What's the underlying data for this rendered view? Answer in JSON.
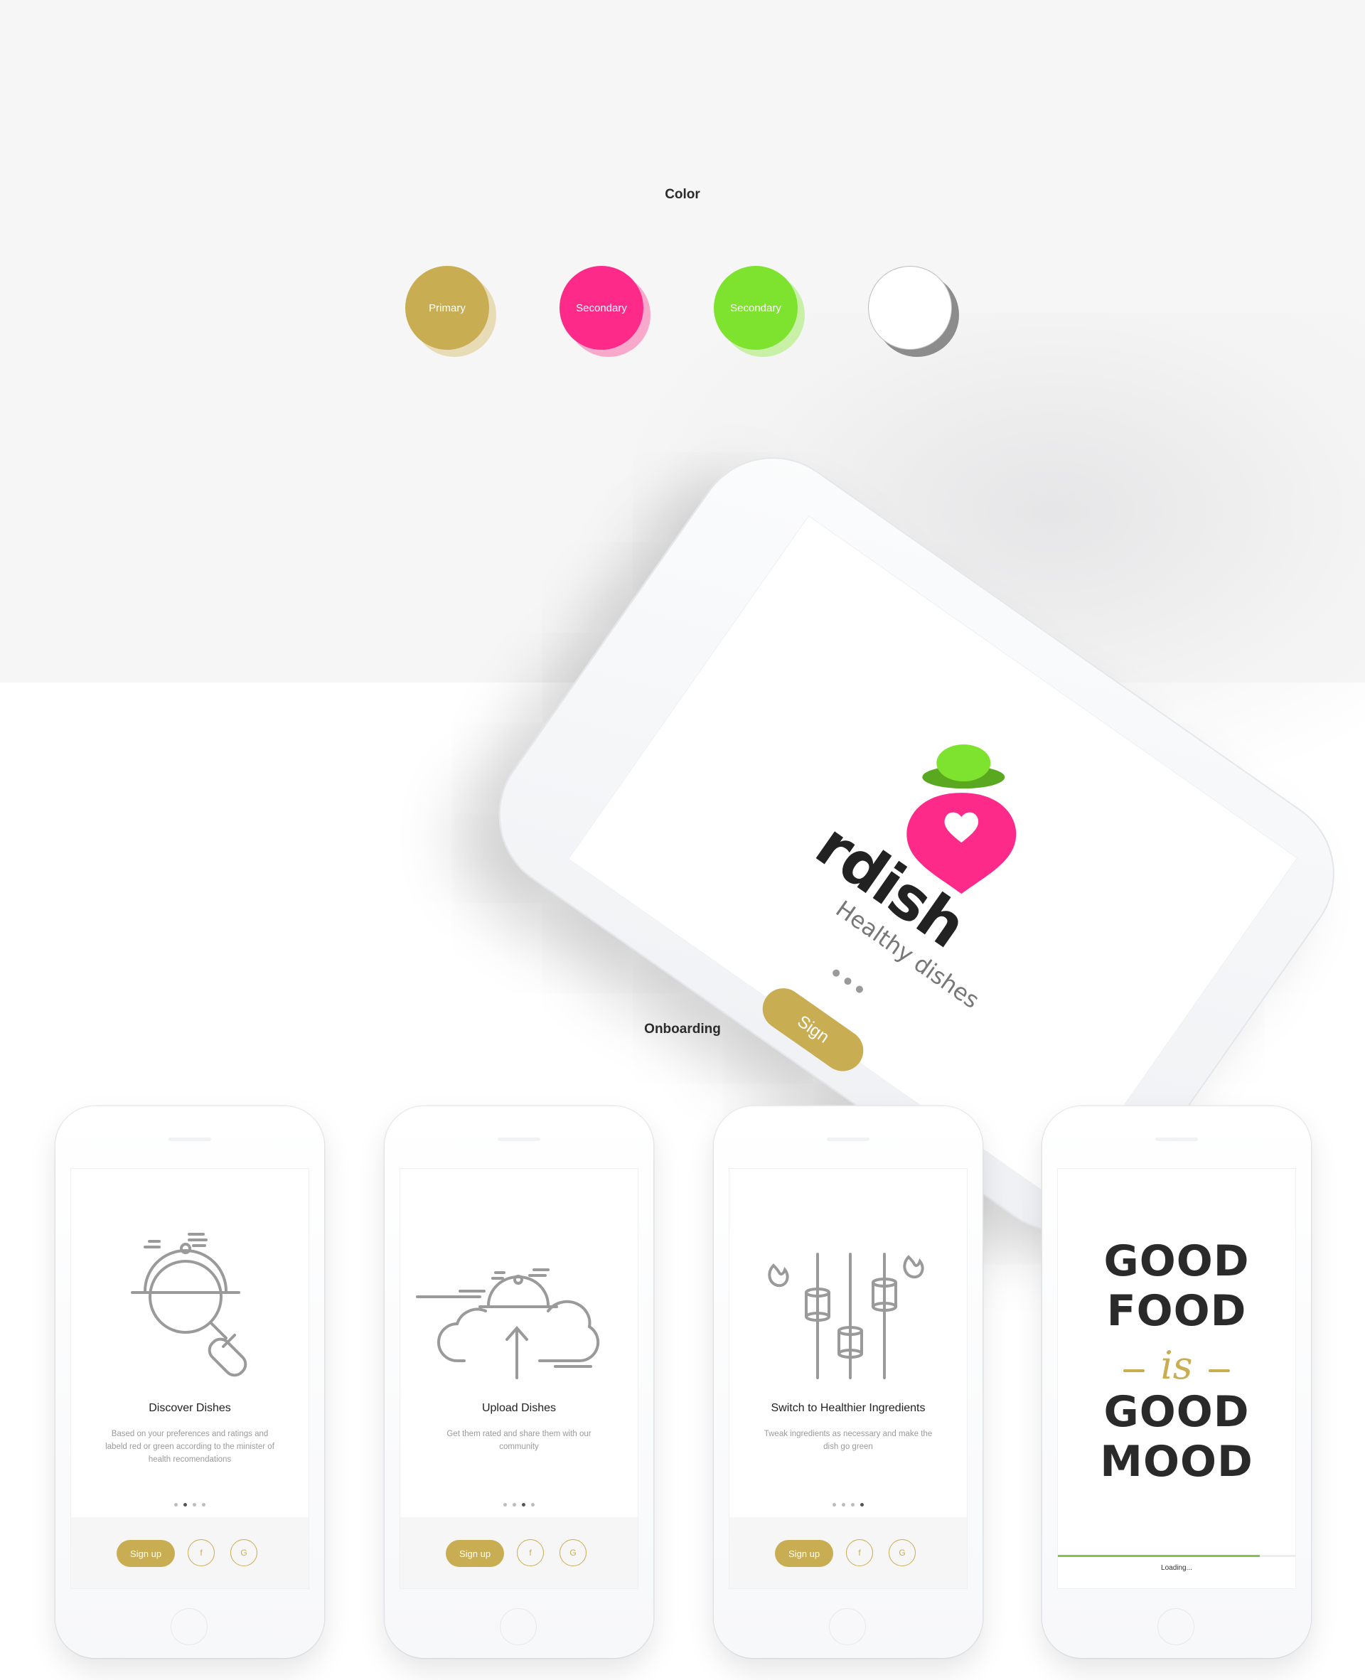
{
  "sections": {
    "color_title": "Color",
    "onboarding_title": "Onboarding"
  },
  "colors": {
    "primary": "#c9ad52",
    "secondary_pink": "#fe2a8a",
    "secondary_green": "#7ee32f",
    "white": "#ffffff"
  },
  "swatches": [
    {
      "label": "Primary",
      "color": "#c9ad52",
      "shadow": "#e8dcb6"
    },
    {
      "label": "Secondary",
      "color": "#fe2a8a",
      "shadow": "#f7a8cb"
    },
    {
      "label": "Secondary",
      "color": "#7ee32f",
      "shadow": "#c8f0a6"
    },
    {
      "label": "",
      "color": "#ffffff",
      "shadow": "#8c8c8c"
    }
  ],
  "splash": {
    "brand": "rdish",
    "tagline": "Healthy dishes",
    "signup_label": "Sign"
  },
  "onboarding": [
    {
      "title": "Discover Dishes",
      "description": "Based on your preferences and ratings and labeld red or green according to the minister of health recomendations",
      "icon": "cloche-magnifier-icon",
      "active_dot": 2
    },
    {
      "title": "Upload Dishes",
      "description": "Get them rated and share them with our community",
      "icon": "cloud-upload-cloche-icon",
      "active_dot": 3
    },
    {
      "title": "Switch to Healthier Ingredients",
      "description": "Tweak ingredients as necessary and make the dish go green",
      "icon": "ingredient-sliders-icon",
      "active_dot": 4
    }
  ],
  "buttons": {
    "signup": "Sign up",
    "facebook": "f",
    "google": "G"
  },
  "quote_screen": {
    "line1": "GOOD",
    "line2": "FOOD",
    "line3": "is",
    "line4": "GOOD",
    "line5": "MOOD",
    "loading": "Loading...",
    "progress": 0.85
  }
}
